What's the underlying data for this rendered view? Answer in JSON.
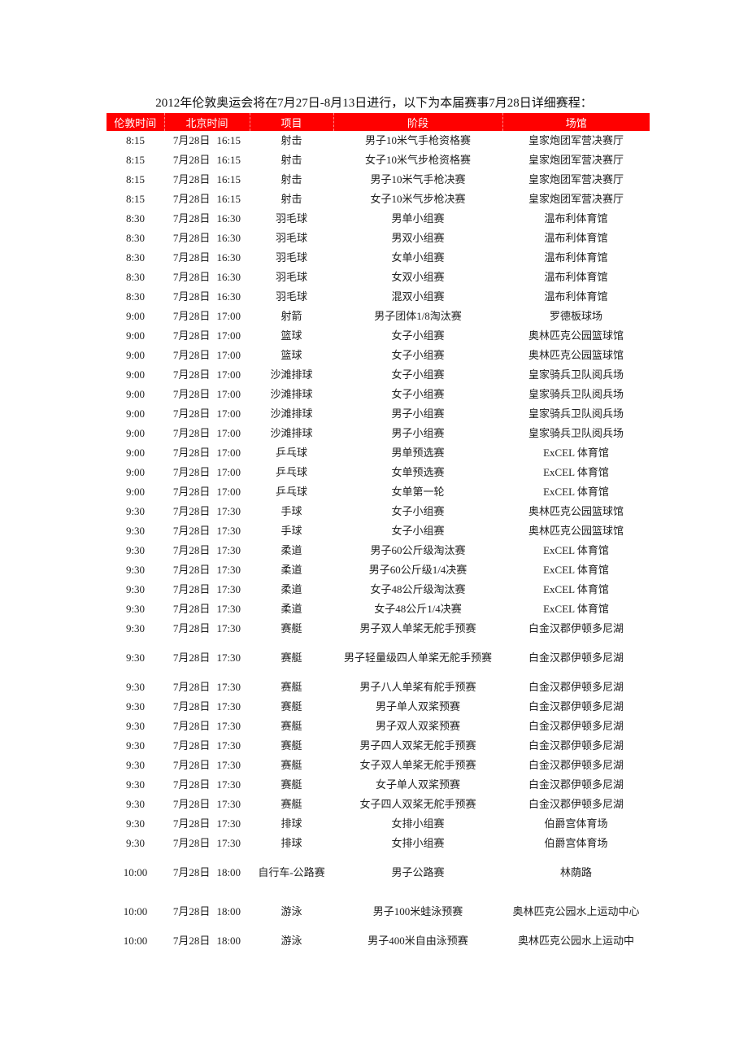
{
  "title": "2012年伦敦奥运会将在7月27日-8月13日进行，以下为本届赛事7月28日详细赛程：",
  "colors": {
    "header_bg": "#ff0000",
    "header_text": "#ffffff"
  },
  "table": {
    "headers": [
      "伦敦时间",
      "北京时间",
      "项目",
      "阶段",
      "场馆"
    ],
    "rows": [
      {
        "london": "8:15",
        "bj_date": "7月28日",
        "bj_time": "16:15",
        "sport": "射击",
        "stage": "男子10米气手枪资格赛",
        "venue": "皇家炮团军营决赛厅"
      },
      {
        "london": "8:15",
        "bj_date": "7月28日",
        "bj_time": "16:15",
        "sport": "射击",
        "stage": "女子10米气步枪资格赛",
        "venue": "皇家炮团军营决赛厅"
      },
      {
        "london": "8:15",
        "bj_date": "7月28日",
        "bj_time": "16:15",
        "sport": "射击",
        "stage": "男子10米气手枪决赛",
        "venue": "皇家炮团军营决赛厅"
      },
      {
        "london": "8:15",
        "bj_date": "7月28日",
        "bj_time": "16:15",
        "sport": "射击",
        "stage": "女子10米气步枪决赛",
        "venue": "皇家炮团军营决赛厅"
      },
      {
        "london": "8:30",
        "bj_date": "7月28日",
        "bj_time": "16:30",
        "sport": "羽毛球",
        "stage": "男单小组赛",
        "venue": "温布利体育馆"
      },
      {
        "london": "8:30",
        "bj_date": "7月28日",
        "bj_time": "16:30",
        "sport": "羽毛球",
        "stage": "男双小组赛",
        "venue": "温布利体育馆"
      },
      {
        "london": "8:30",
        "bj_date": "7月28日",
        "bj_time": "16:30",
        "sport": "羽毛球",
        "stage": "女单小组赛",
        "venue": "温布利体育馆"
      },
      {
        "london": "8:30",
        "bj_date": "7月28日",
        "bj_time": "16:30",
        "sport": "羽毛球",
        "stage": "女双小组赛",
        "venue": "温布利体育馆"
      },
      {
        "london": "8:30",
        "bj_date": "7月28日",
        "bj_time": "16:30",
        "sport": "羽毛球",
        "stage": "混双小组赛",
        "venue": "温布利体育馆"
      },
      {
        "london": "9:00",
        "bj_date": "7月28日",
        "bj_time": "17:00",
        "sport": "射箭",
        "stage": "男子团体1/8淘汰赛",
        "venue": "罗德板球场"
      },
      {
        "london": "9:00",
        "bj_date": "7月28日",
        "bj_time": "17:00",
        "sport": "篮球",
        "stage": "女子小组赛",
        "venue": "奥林匹克公园篮球馆"
      },
      {
        "london": "9:00",
        "bj_date": "7月28日",
        "bj_time": "17:00",
        "sport": "篮球",
        "stage": "女子小组赛",
        "venue": "奥林匹克公园篮球馆"
      },
      {
        "london": "9:00",
        "bj_date": "7月28日",
        "bj_time": "17:00",
        "sport": "沙滩排球",
        "stage": "女子小组赛",
        "venue": "皇家骑兵卫队阅兵场"
      },
      {
        "london": "9:00",
        "bj_date": "7月28日",
        "bj_time": "17:00",
        "sport": "沙滩排球",
        "stage": "女子小组赛",
        "venue": "皇家骑兵卫队阅兵场"
      },
      {
        "london": "9:00",
        "bj_date": "7月28日",
        "bj_time": "17:00",
        "sport": "沙滩排球",
        "stage": "男子小组赛",
        "venue": "皇家骑兵卫队阅兵场"
      },
      {
        "london": "9:00",
        "bj_date": "7月28日",
        "bj_time": "17:00",
        "sport": "沙滩排球",
        "stage": "男子小组赛",
        "venue": "皇家骑兵卫队阅兵场"
      },
      {
        "london": "9:00",
        "bj_date": "7月28日",
        "bj_time": "17:00",
        "sport": "乒乓球",
        "stage": "男单预选赛",
        "venue": "ExCEL 体育馆"
      },
      {
        "london": "9:00",
        "bj_date": "7月28日",
        "bj_time": "17:00",
        "sport": "乒乓球",
        "stage": "女单预选赛",
        "venue": "ExCEL 体育馆"
      },
      {
        "london": "9:00",
        "bj_date": "7月28日",
        "bj_time": "17:00",
        "sport": "乒乓球",
        "stage": "女单第一轮",
        "venue": "ExCEL 体育馆"
      },
      {
        "london": "9:30",
        "bj_date": "7月28日",
        "bj_time": "17:30",
        "sport": "手球",
        "stage": "女子小组赛",
        "venue": "奥林匹克公园篮球馆"
      },
      {
        "london": "9:30",
        "bj_date": "7月28日",
        "bj_time": "17:30",
        "sport": "手球",
        "stage": "女子小组赛",
        "venue": "奥林匹克公园篮球馆"
      },
      {
        "london": "9:30",
        "bj_date": "7月28日",
        "bj_time": "17:30",
        "sport": "柔道",
        "stage": "男子60公斤级淘汰赛",
        "venue": "ExCEL 体育馆"
      },
      {
        "london": "9:30",
        "bj_date": "7月28日",
        "bj_time": "17:30",
        "sport": "柔道",
        "stage": "男子60公斤级1/4决赛",
        "venue": "ExCEL 体育馆"
      },
      {
        "london": "9:30",
        "bj_date": "7月28日",
        "bj_time": "17:30",
        "sport": "柔道",
        "stage": "女子48公斤级淘汰赛",
        "venue": "ExCEL 体育馆"
      },
      {
        "london": "9:30",
        "bj_date": "7月28日",
        "bj_time": "17:30",
        "sport": "柔道",
        "stage": "女子48公斤1/4决赛",
        "venue": "ExCEL 体育馆"
      },
      {
        "london": "9:30",
        "bj_date": "7月28日",
        "bj_time": "17:30",
        "sport": "赛艇",
        "stage": "男子双人单桨无舵手预赛",
        "venue": "白金汉郡伊顿多尼湖"
      },
      {
        "london": "9:30",
        "bj_date": "7月28日",
        "bj_time": "17:30",
        "sport": "赛艇",
        "stage": "男子轻量级四人单桨无舵手预赛",
        "venue": "白金汉郡伊顿多尼湖",
        "tall": true
      },
      {
        "london": "9:30",
        "bj_date": "7月28日",
        "bj_time": "17:30",
        "sport": "赛艇",
        "stage": "男子八人单桨有舵手预赛",
        "venue": "白金汉郡伊顿多尼湖"
      },
      {
        "london": "9:30",
        "bj_date": "7月28日",
        "bj_time": "17:30",
        "sport": "赛艇",
        "stage": "男子单人双桨预赛",
        "venue": "白金汉郡伊顿多尼湖"
      },
      {
        "london": "9:30",
        "bj_date": "7月28日",
        "bj_time": "17:30",
        "sport": "赛艇",
        "stage": "男子双人双桨预赛",
        "venue": "白金汉郡伊顿多尼湖"
      },
      {
        "london": "9:30",
        "bj_date": "7月28日",
        "bj_time": "17:30",
        "sport": "赛艇",
        "stage": "男子四人双桨无舵手预赛",
        "venue": "白金汉郡伊顿多尼湖"
      },
      {
        "london": "9:30",
        "bj_date": "7月28日",
        "bj_time": "17:30",
        "sport": "赛艇",
        "stage": "女子双人单桨无舵手预赛",
        "venue": "白金汉郡伊顿多尼湖"
      },
      {
        "london": "9:30",
        "bj_date": "7月28日",
        "bj_time": "17:30",
        "sport": "赛艇",
        "stage": "女子单人双桨预赛",
        "venue": "白金汉郡伊顿多尼湖"
      },
      {
        "london": "9:30",
        "bj_date": "7月28日",
        "bj_time": "17:30",
        "sport": "赛艇",
        "stage": "女子四人双桨无舵手预赛",
        "venue": "白金汉郡伊顿多尼湖"
      },
      {
        "london": "9:30",
        "bj_date": "7月28日",
        "bj_time": "17:30",
        "sport": "排球",
        "stage": "女排小组赛",
        "venue": "伯爵宫体育场"
      },
      {
        "london": "9:30",
        "bj_date": "7月28日",
        "bj_time": "17:30",
        "sport": "排球",
        "stage": "女排小组赛",
        "venue": "伯爵宫体育场"
      },
      {
        "london": "10:00",
        "bj_date": "7月28日",
        "bj_time": "18:00",
        "sport": "自行车-公路赛",
        "stage": "男子公路赛",
        "venue": "林荫路",
        "tall": true
      },
      {
        "london": "10:00",
        "bj_date": "7月28日",
        "bj_time": "18:00",
        "sport": "游泳",
        "stage": "男子100米蛙泳预赛",
        "venue": "奥林匹克公园水上运动中心",
        "tall": true
      },
      {
        "london": "10:00",
        "bj_date": "7月28日",
        "bj_time": "18:00",
        "sport": "游泳",
        "stage": "男子400米自由泳预赛",
        "venue": "奥林匹克公园水上运动中"
      }
    ]
  }
}
